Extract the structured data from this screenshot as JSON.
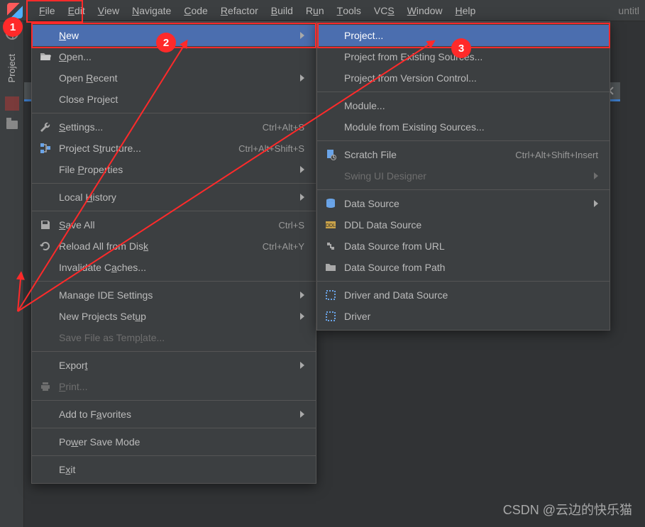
{
  "app": {
    "title_right": "untitl"
  },
  "menubar": {
    "items": [
      {
        "pre": "",
        "u": "F",
        "post": "ile"
      },
      {
        "pre": "",
        "u": "E",
        "post": "dit"
      },
      {
        "pre": "",
        "u": "V",
        "post": "iew"
      },
      {
        "pre": "",
        "u": "N",
        "post": "avigate"
      },
      {
        "pre": "",
        "u": "C",
        "post": "ode"
      },
      {
        "pre": "",
        "u": "R",
        "post": "efactor"
      },
      {
        "pre": "",
        "u": "B",
        "post": "uild"
      },
      {
        "pre": "R",
        "u": "u",
        "post": "n"
      },
      {
        "pre": "",
        "u": "T",
        "post": "ools"
      },
      {
        "pre": "VC",
        "u": "S",
        "post": ""
      },
      {
        "pre": "",
        "u": "W",
        "post": "indow"
      },
      {
        "pre": "",
        "u": "H",
        "post": "elp"
      }
    ]
  },
  "sidebar": {
    "project_tab_label": "Project"
  },
  "file_menu": {
    "new": {
      "pre": "",
      "u": "N",
      "post": "ew"
    },
    "open": {
      "pre": "",
      "u": "O",
      "post": "pen..."
    },
    "open_recent": {
      "pre": "Open ",
      "u": "R",
      "post": "ecent"
    },
    "close_project": {
      "pre": "Close Pro",
      "u": "j",
      "post": "ect"
    },
    "settings": {
      "pre": "",
      "u": "S",
      "post": "ettings...",
      "shortcut": "Ctrl+Alt+S"
    },
    "project_struct": {
      "pre": "Project S",
      "u": "t",
      "post": "ructure...",
      "shortcut": "Ctrl+Alt+Shift+S"
    },
    "file_props": {
      "pre": "File ",
      "u": "P",
      "post": "roperties"
    },
    "local_history": {
      "pre": "Local ",
      "u": "H",
      "post": "istory"
    },
    "save_all": {
      "pre": "",
      "u": "S",
      "post": "ave All",
      "shortcut": "Ctrl+S"
    },
    "reload": {
      "pre": "Reload All from Dis",
      "u": "k",
      "post": "",
      "shortcut": "Ctrl+Alt+Y"
    },
    "invalidate": {
      "pre": "Invalidate C",
      "u": "a",
      "post": "ches..."
    },
    "manage_ide": {
      "pre": "Manage IDE Settin",
      "u": "g",
      "post": "s"
    },
    "new_proj_setup": {
      "pre": "New Projects Set",
      "u": "u",
      "post": "p"
    },
    "save_template": {
      "pre": "Save File as Temp",
      "u": "l",
      "post": "ate..."
    },
    "export": {
      "pre": "Expor",
      "u": "t",
      "post": ""
    },
    "print": {
      "pre": "",
      "u": "P",
      "post": "rint..."
    },
    "add_fav": {
      "pre": "Add to F",
      "u": "a",
      "post": "vorites"
    },
    "power_save": {
      "pre": "Po",
      "u": "w",
      "post": "er Save Mode"
    },
    "exit": {
      "pre": "E",
      "u": "x",
      "post": "it"
    }
  },
  "new_menu": {
    "project": {
      "label": "Project..."
    },
    "from_existing": {
      "label": "Project from Existing Sources..."
    },
    "from_vcs": {
      "label": "Project from Version Control..."
    },
    "module": {
      "label": "Module..."
    },
    "module_existing": {
      "label": "Module from Existing Sources..."
    },
    "scratch": {
      "label": "Scratch File",
      "shortcut": "Ctrl+Alt+Shift+Insert"
    },
    "swing": {
      "label": "Swing UI Designer"
    },
    "data_source": {
      "label": "Data Source"
    },
    "ddl": {
      "label": "DDL Data Source"
    },
    "ds_url": {
      "label": "Data Source from URL"
    },
    "ds_path": {
      "label": "Data Source from Path"
    },
    "driver_ds": {
      "label": "Driver and Data Source"
    },
    "driver": {
      "label": "Driver"
    }
  },
  "annotations": {
    "marker1": "1",
    "marker2": "2",
    "marker3": "3",
    "watermark": "CSDN @云边的快乐猫"
  }
}
